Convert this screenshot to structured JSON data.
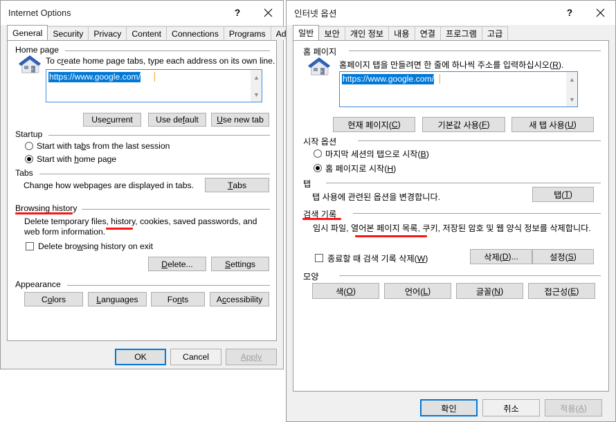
{
  "left_dialog": {
    "title": "Internet Options",
    "titlebar_buttons": {
      "help": "?",
      "close": "close-icon"
    },
    "tabs": [
      {
        "label": "General",
        "active": true
      },
      {
        "label": "Security",
        "active": false
      },
      {
        "label": "Privacy",
        "active": false
      },
      {
        "label": "Content",
        "active": false
      },
      {
        "label": "Connections",
        "active": false
      },
      {
        "label": "Programs",
        "active": false
      },
      {
        "label": "Advanced",
        "active": false
      }
    ],
    "home_page": {
      "group_label": "Home page",
      "description": "To create home page tabs, type each address on its own line.",
      "value": "https://www.google.com/",
      "buttons": [
        "Use current",
        "Use default",
        "Use new tab"
      ]
    },
    "startup": {
      "group_label": "Startup",
      "options": [
        {
          "label": "Start with tabs from the last session",
          "checked": false
        },
        {
          "label": "Start with home page",
          "checked": true
        }
      ]
    },
    "tabs_section": {
      "group_label": "Tabs",
      "description": "Change how webpages are displayed in tabs.",
      "button": "Tabs"
    },
    "browsing_history": {
      "group_label": "Browsing history",
      "description": "Delete temporary files, history, cookies, saved passwords, and web form information.",
      "checkbox": {
        "label": "Delete browsing history on exit",
        "checked": false
      },
      "buttons": [
        "Delete...",
        "Settings"
      ]
    },
    "appearance": {
      "group_label": "Appearance",
      "buttons": [
        "Colors",
        "Languages",
        "Fonts",
        "Accessibility"
      ]
    },
    "footer": {
      "ok": "OK",
      "cancel": "Cancel",
      "apply": "Apply",
      "apply_disabled": true
    }
  },
  "right_dialog": {
    "title": "인터넷 옵션",
    "titlebar_buttons": {
      "help": "?",
      "close": "close-icon"
    },
    "tabs": [
      {
        "label": "일반",
        "active": true
      },
      {
        "label": "보안",
        "active": false
      },
      {
        "label": "개인 정보",
        "active": false
      },
      {
        "label": "내용",
        "active": false
      },
      {
        "label": "연결",
        "active": false
      },
      {
        "label": "프로그램",
        "active": false
      },
      {
        "label": "고급",
        "active": false
      }
    ],
    "home_page": {
      "group_label": "홈 페이지",
      "description": "홈페이지 탭을 만들려면 한 줄에 하나씩 주소를 입력하십시오(R).",
      "value": "https://www.google.com/",
      "buttons": [
        "현재 페이지(C)",
        "기본값 사용(F)",
        "새 탭 사용(U)"
      ]
    },
    "startup": {
      "group_label": "시작 옵션",
      "options": [
        {
          "label": "마지막 세션의 탭으로 시작(B)",
          "checked": false
        },
        {
          "label": "홈 페이지로 시작(H)",
          "checked": true
        }
      ]
    },
    "tabs_section": {
      "group_label": "탭",
      "description": "탭 사용에 관련된 옵션을 변경합니다.",
      "button": "탭(T)"
    },
    "browsing_history": {
      "group_label": "검색 기록",
      "description": "임시 파일, 열어본 페이지 목록, 쿠키, 저장된 암호 및 웹 양식 정보를 삭제합니다.",
      "checkbox": {
        "label": "종료할 때 검색 기록 삭제(W)",
        "checked": false
      },
      "buttons": [
        "삭제(D)...",
        "설정(S)"
      ]
    },
    "appearance": {
      "group_label": "모양",
      "buttons": [
        "색(O)",
        "언어(L)",
        "글꼴(N)",
        "접근성(E)"
      ]
    },
    "footer": {
      "ok": "확인",
      "cancel": "취소",
      "apply": "적용(A)",
      "apply_disabled": true
    }
  },
  "annotations": {
    "color": "#fc1414",
    "marks": [
      {
        "target": "left-browsing-history-label"
      },
      {
        "target": "left-history-word"
      },
      {
        "target": "right-search-history-label"
      },
      {
        "target": "right-visited-pages-phrase"
      }
    ]
  }
}
